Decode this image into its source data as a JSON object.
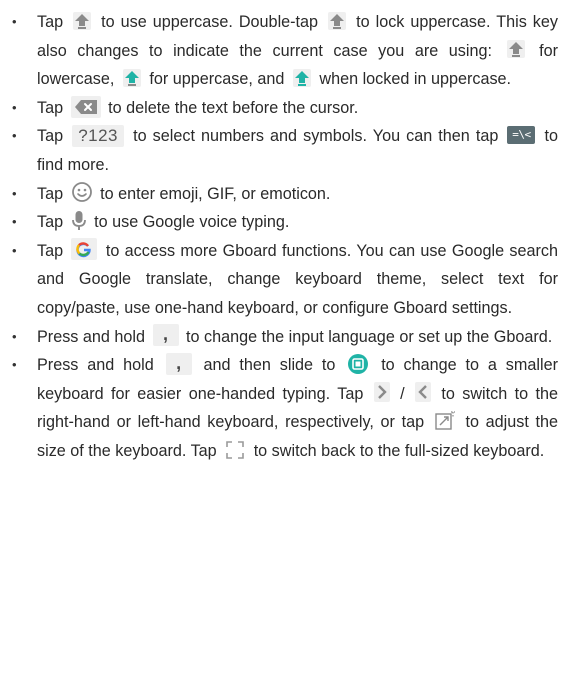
{
  "bullets": [
    {
      "t1": "Tap",
      "t2": "to use uppercase. Double-tap",
      "t3": "to lock uppercase. This key also changes to indicate the current case you are using:",
      "t4": "for lowercase,",
      "t5": "for uppercase, and",
      "t6": "when locked in uppercase."
    },
    {
      "t1": "Tap",
      "t2": "to delete the text before the cursor."
    },
    {
      "t1": "Tap",
      "key_label": "?123",
      "t2": "to select numbers and symbols. You can then tap",
      "sym_label": "=\\<",
      "t3": "to find more."
    },
    {
      "t1": "Tap",
      "t2": "to enter emoji, GIF, or emoticon."
    },
    {
      "t1": "Tap",
      "t2": "to use Google voice typing."
    },
    {
      "t1": "Tap",
      "t2": "to access more Gboard functions. You can use Google search and Google translate, change keyboard theme, select text for copy/paste, use one-hand keyboard, or configure Gboard settings."
    },
    {
      "t1": "Press and hold",
      "key_label": ",",
      "t2": "to change the input language or set up the Gboard."
    },
    {
      "t1": "Press and hold",
      "key_label": ",",
      "t2": "and then slide to",
      "t3": "to change to a smaller keyboard for easier one-handed typing. Tap",
      "sep": "/",
      "t4": "to switch to the right-hand or left-hand keyboard, respectively, or tap",
      "t5": "to adjust the size of the keyboard. Tap",
      "t6": "to switch back to the full-sized keyboard."
    }
  ],
  "icons": {
    "shift": "shift-arrow-icon",
    "delete": "backspace-icon",
    "emoji": "smiley-icon",
    "mic": "microphone-icon",
    "google": "google-g-icon",
    "one_hand": "one-hand-keyboard-icon",
    "chevron_right": "chevron-right-icon",
    "chevron_left": "chevron-left-icon",
    "resize": "resize-icon",
    "expand": "expand-icon"
  },
  "colors": {
    "text": "#2a2a2a",
    "teal": "#1fb3a6",
    "key_bg": "#efefef",
    "icon_gray": "#8a8a8a",
    "symbol_key": "#5b6d73"
  }
}
